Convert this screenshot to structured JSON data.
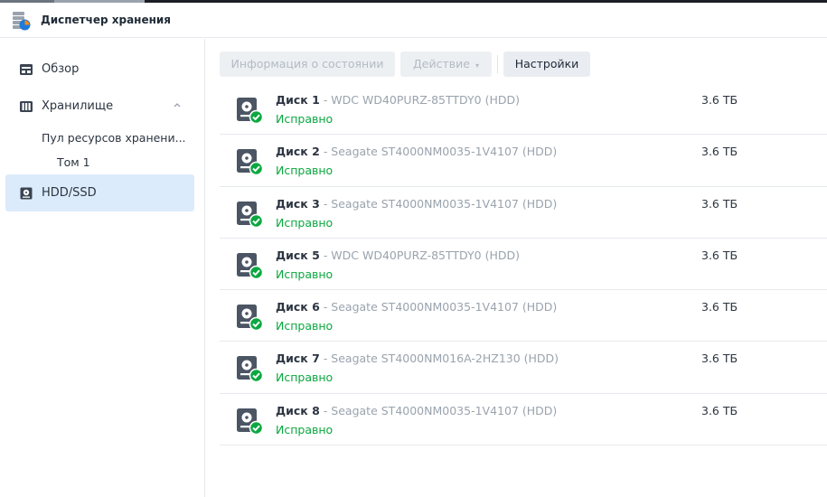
{
  "app": {
    "title": "Диспетчер хранения"
  },
  "sidebar": {
    "items": [
      {
        "label": "Обзор"
      },
      {
        "label": "Хранилище"
      },
      {
        "label": "HDD/SSD"
      }
    ],
    "subitems": [
      {
        "label": "Пул ресурсов хранени..."
      },
      {
        "label": "Том 1"
      }
    ]
  },
  "toolbar": {
    "status_info_label": "Информация о состоянии",
    "action_label": "Действие",
    "settings_label": "Настройки"
  },
  "disks": [
    {
      "name": "Диск 1",
      "model": " - WDC WD40PURZ-85TTDY0 (HDD)",
      "status": "Исправно",
      "size": "3.6 ТБ"
    },
    {
      "name": "Диск 2",
      "model": " - Seagate ST4000NM0035-1V4107 (HDD)",
      "status": "Исправно",
      "size": "3.6 ТБ"
    },
    {
      "name": "Диск 3",
      "model": " - Seagate ST4000NM0035-1V4107 (HDD)",
      "status": "Исправно",
      "size": "3.6 ТБ"
    },
    {
      "name": "Диск 5",
      "model": " - WDC WD40PURZ-85TTDY0 (HDD)",
      "status": "Исправно",
      "size": "3.6 ТБ"
    },
    {
      "name": "Диск 6",
      "model": " - Seagate ST4000NM0035-1V4107 (HDD)",
      "status": "Исправно",
      "size": "3.6 ТБ"
    },
    {
      "name": "Диск 7",
      "model": " - Seagate ST4000NM016A-2HZ130 (HDD)",
      "status": "Исправно",
      "size": "3.6 ТБ"
    },
    {
      "name": "Диск 8",
      "model": " - Seagate ST4000NM0035-1V4107 (HDD)",
      "status": "Исправно",
      "size": "3.6 ТБ"
    }
  ],
  "colors": {
    "accent": "#dcebfb",
    "healthy": "#0aa83f"
  }
}
